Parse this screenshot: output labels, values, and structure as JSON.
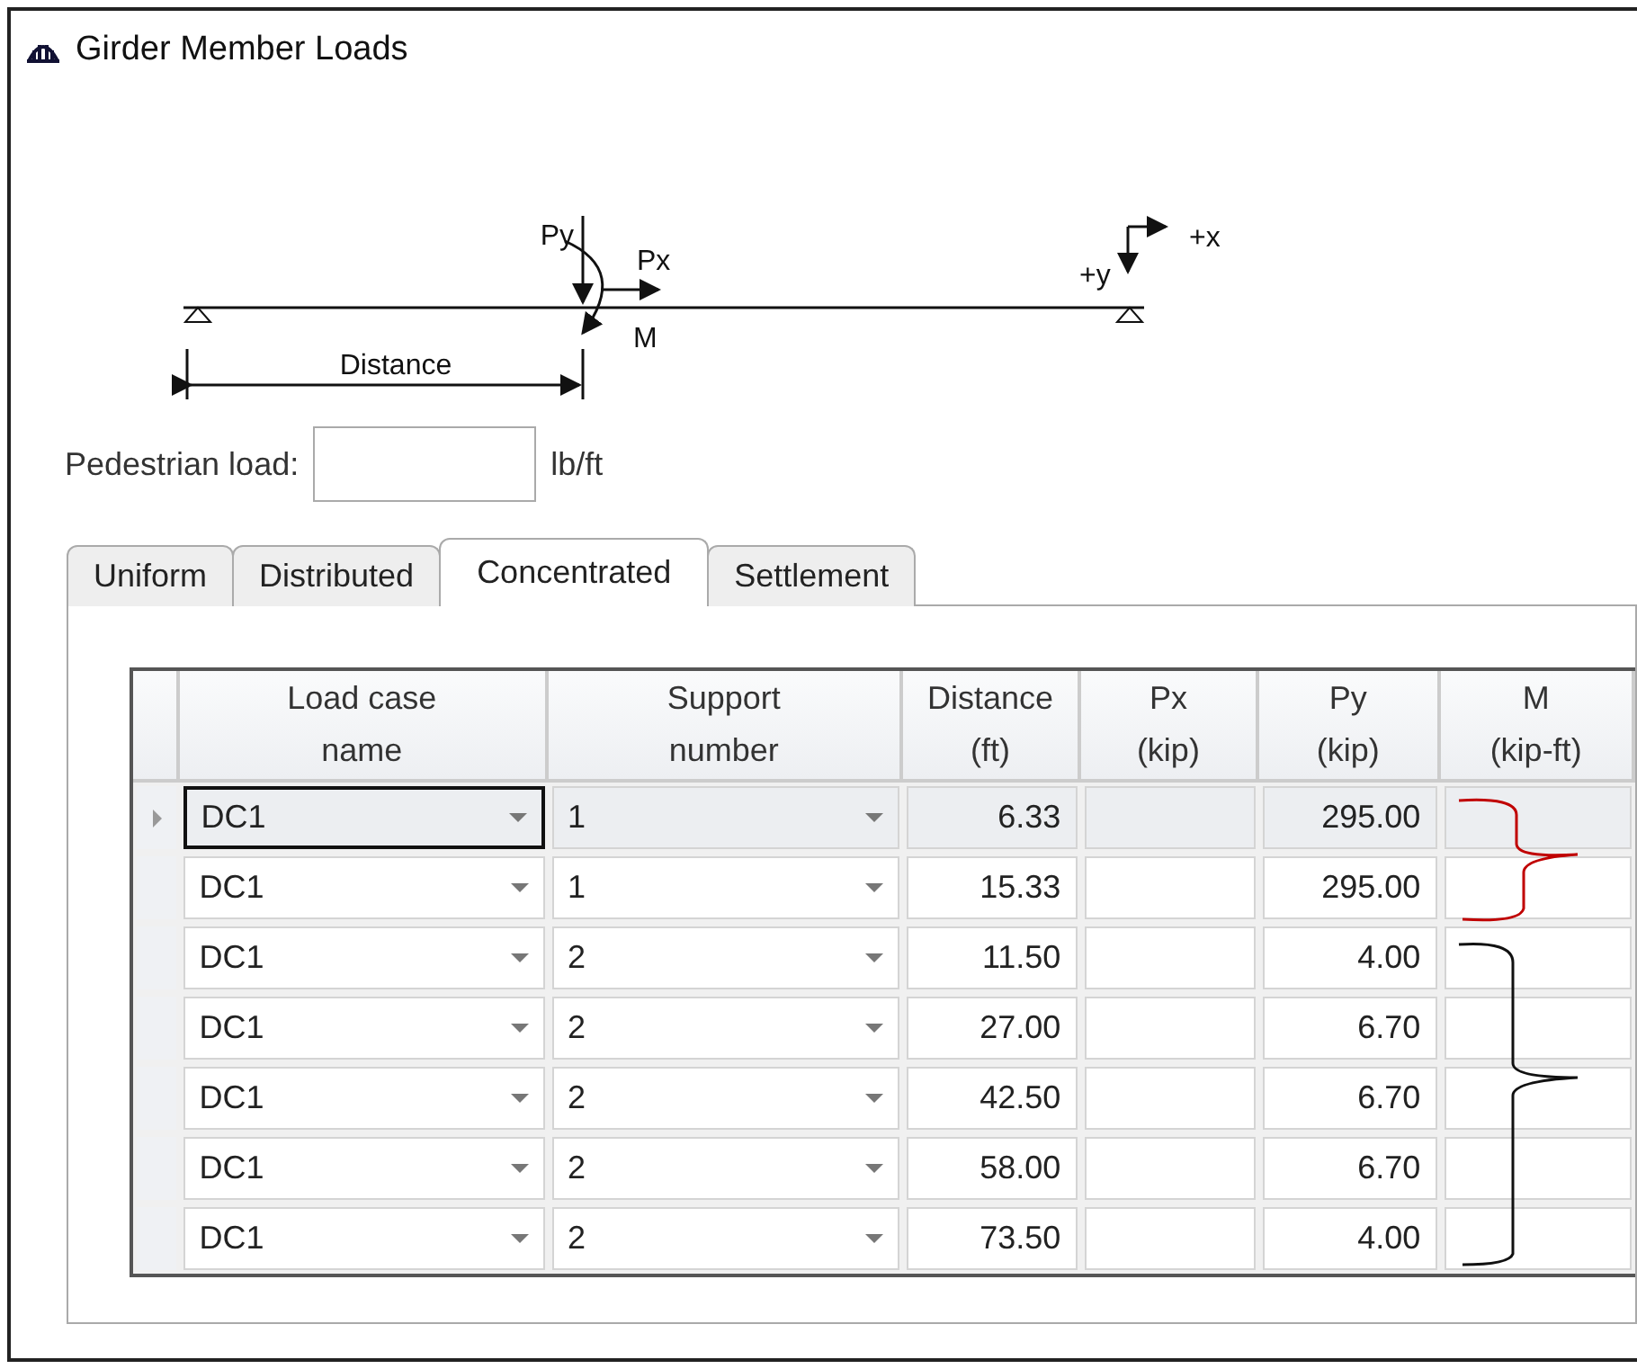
{
  "window": {
    "title": "Girder Member Loads"
  },
  "diagram": {
    "labels": [
      {
        "kind": "py",
        "text": "Py"
      },
      {
        "kind": "px",
        "text": "Px"
      },
      {
        "kind": "m",
        "text": "M"
      },
      {
        "kind": "distance",
        "text": "Distance"
      },
      {
        "kind": "x_axis",
        "text": "+x"
      },
      {
        "kind": "y_axis",
        "text": "+y"
      }
    ]
  },
  "pedestrian_load": {
    "label": "Pedestrian load:",
    "unit": "lb/ft"
  },
  "tabs": [
    {
      "label": "Uniform",
      "selected": false
    },
    {
      "label": "Distributed",
      "selected": false
    },
    {
      "label": "Concentrated",
      "selected": true
    },
    {
      "label": "Settlement",
      "selected": false
    }
  ],
  "table": {
    "columns": [
      {
        "label": "Load case\nname",
        "kind": "dropdown"
      },
      {
        "label": "Support\nnumber",
        "kind": "dropdown"
      },
      {
        "label": "Distance\n(ft)",
        "kind": "number"
      },
      {
        "label": "Px\n(kip)",
        "kind": "number"
      },
      {
        "label": "Py\n(kip)",
        "kind": "number"
      },
      {
        "label": "M\n(kip-ft)",
        "kind": "number"
      }
    ],
    "rows": [
      {
        "selected": true,
        "cells": [
          "DC1",
          "1",
          "6.33",
          "",
          "295.00",
          ""
        ]
      },
      {
        "selected": false,
        "cells": [
          "DC1",
          "1",
          "15.33",
          "",
          "295.00",
          ""
        ]
      },
      {
        "selected": false,
        "cells": [
          "DC1",
          "2",
          "11.50",
          "",
          "4.00",
          ""
        ]
      },
      {
        "selected": false,
        "cells": [
          "DC1",
          "2",
          "27.00",
          "",
          "6.70",
          ""
        ]
      },
      {
        "selected": false,
        "cells": [
          "DC1",
          "2",
          "42.50",
          "",
          "6.70",
          ""
        ]
      },
      {
        "selected": false,
        "cells": [
          "DC1",
          "2",
          "58.00",
          "",
          "6.70",
          ""
        ]
      },
      {
        "selected": false,
        "cells": [
          "DC1",
          "2",
          "73.50",
          "",
          "4.00",
          ""
        ]
      }
    ]
  }
}
